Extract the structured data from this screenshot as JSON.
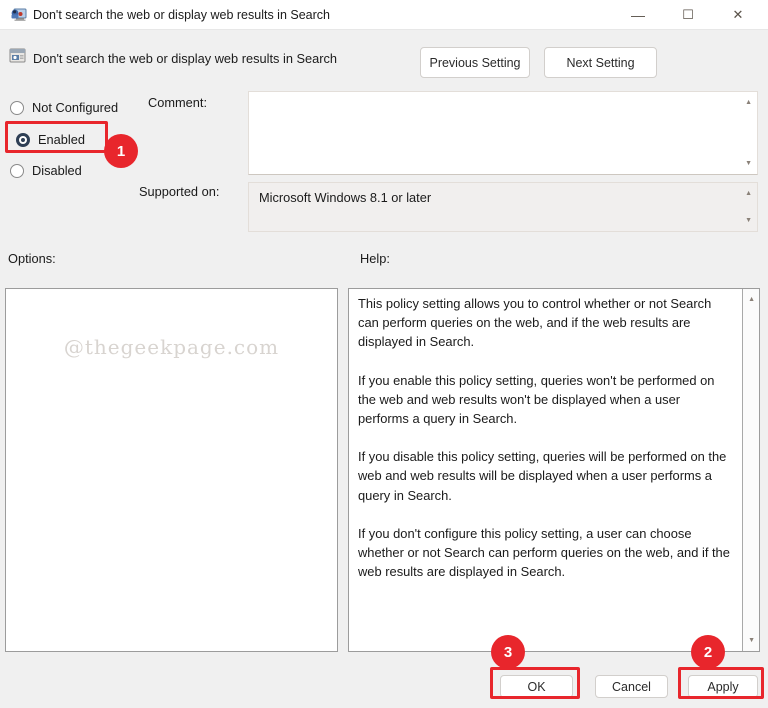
{
  "window": {
    "title": "Don't search the web or display web results in Search",
    "minimize_glyph": "—",
    "maximize_glyph": "☐",
    "close_glyph": "✕"
  },
  "header": {
    "policy_name": "Don't search the web or display web results in Search",
    "previous_button": "Previous Setting",
    "next_button": "Next Setting"
  },
  "radios": [
    {
      "label": "Not Configured",
      "selected": false
    },
    {
      "label": "Enabled",
      "selected": true
    },
    {
      "label": "Disabled",
      "selected": false
    }
  ],
  "comment": {
    "label": "Comment:",
    "value": ""
  },
  "supported": {
    "label": "Supported on:",
    "value": "Microsoft Windows 8.1 or later"
  },
  "options_section": {
    "label": "Options:",
    "watermark": "@thegeekpage.com"
  },
  "help": {
    "label": "Help:",
    "paragraphs": [
      "This policy setting allows you to control whether or not Search can perform queries on the web, and if the web results are displayed in Search.",
      "If you enable this policy setting, queries won't be performed on the web and web results won't be displayed when a user performs a query in Search.",
      "If you disable this policy setting, queries will be performed on the web and web results will be displayed when a user performs a query in Search.",
      "If you don't configure this policy setting, a user can choose whether or not Search can perform queries on the web, and if the web results are displayed in Search."
    ]
  },
  "footer": {
    "ok_label": "OK",
    "cancel_label": "Cancel",
    "apply_label": "Apply"
  },
  "scroll": {
    "up_glyph": "▲",
    "down_glyph": "▼"
  },
  "annotations": {
    "color": "#e8262c",
    "step_1": "1",
    "step_2": "2",
    "step_3": "3"
  }
}
